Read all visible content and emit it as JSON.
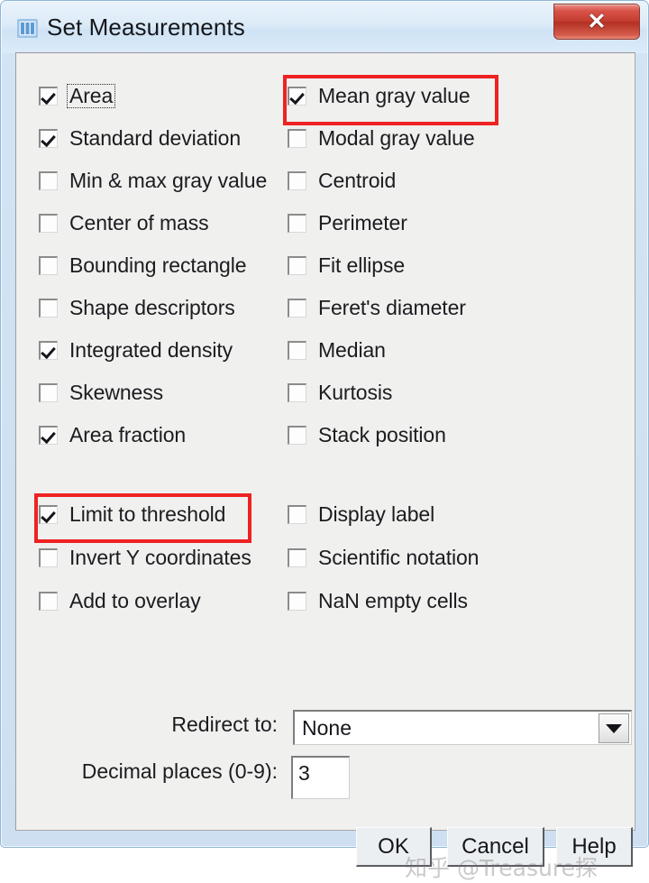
{
  "window": {
    "title": "Set Measurements",
    "icon": "imagej-measure-icon",
    "close_label": "✕",
    "frame_color": "#cfe2f3",
    "panel_color": "#f0f0ef"
  },
  "annotation": {
    "highlight_color": "#ee2222",
    "highlighted_items": [
      "Mean gray value",
      "Limit to threshold"
    ]
  },
  "measurements": {
    "left_column": [
      {
        "label": "Area",
        "checked": true,
        "focused": true
      },
      {
        "label": "Standard deviation",
        "checked": true,
        "focused": false
      },
      {
        "label": "Min & max gray value",
        "checked": false,
        "focused": false
      },
      {
        "label": "Center of mass",
        "checked": false,
        "focused": false
      },
      {
        "label": "Bounding rectangle",
        "checked": false,
        "focused": false
      },
      {
        "label": "Shape descriptors",
        "checked": false,
        "focused": false
      },
      {
        "label": "Integrated density",
        "checked": true,
        "focused": false
      },
      {
        "label": "Skewness",
        "checked": false,
        "focused": false
      },
      {
        "label": "Area fraction",
        "checked": true,
        "focused": false
      }
    ],
    "right_column": [
      {
        "label": "Mean gray value",
        "checked": true,
        "highlighted": true
      },
      {
        "label": "Modal gray value",
        "checked": false,
        "highlighted": false
      },
      {
        "label": "Centroid",
        "checked": false,
        "highlighted": false
      },
      {
        "label": "Perimeter",
        "checked": false,
        "highlighted": false
      },
      {
        "label": "Fit ellipse",
        "checked": false,
        "highlighted": false
      },
      {
        "label": "Feret's diameter",
        "checked": false,
        "highlighted": false
      },
      {
        "label": "Median",
        "checked": false,
        "highlighted": false
      },
      {
        "label": "Kurtosis",
        "checked": false,
        "highlighted": false
      },
      {
        "label": "Stack position",
        "checked": false,
        "highlighted": false
      }
    ]
  },
  "options": {
    "left_column": [
      {
        "label": "Limit to threshold",
        "checked": true,
        "highlighted": true
      },
      {
        "label": "Invert Y coordinates",
        "checked": false,
        "highlighted": false
      },
      {
        "label": "Add to overlay",
        "checked": false,
        "highlighted": false
      }
    ],
    "right_column": [
      {
        "label": "Display label",
        "checked": false
      },
      {
        "label": "Scientific notation",
        "checked": false
      },
      {
        "label": "NaN empty cells",
        "checked": false
      }
    ]
  },
  "redirect": {
    "label": "Redirect to:",
    "value": "None",
    "options": [
      "None"
    ]
  },
  "decimal": {
    "label": "Decimal places (0-9):",
    "value": "3"
  },
  "buttons": {
    "ok": "OK",
    "cancel": "Cancel",
    "help": "Help"
  },
  "watermark": {
    "text": "知乎 @Treasure探"
  }
}
